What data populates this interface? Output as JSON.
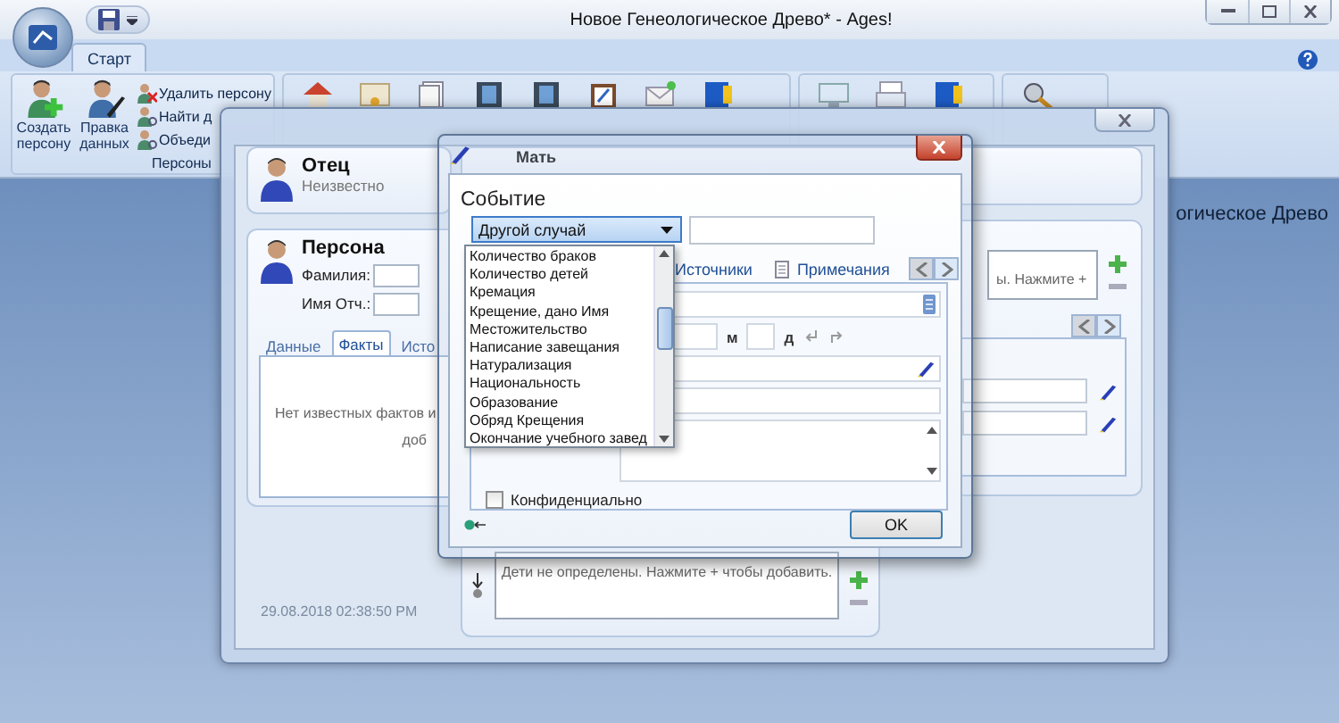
{
  "window": {
    "title": "Новое Генеологическое Древо* - Ages!"
  },
  "ribbon": {
    "tabs": [
      {
        "label": "Старт",
        "selected": true
      }
    ],
    "group": {
      "label": "Персоны",
      "large_buttons": [
        "Создать персону",
        "Правка данных"
      ],
      "small_buttons": [
        "Удалить персону",
        "Найти д",
        "Объеди"
      ]
    }
  },
  "workspace": {
    "heading": "огическое Древо"
  },
  "person_window": {
    "father": {
      "title": "Отец",
      "subtitle": "Неизвестно"
    },
    "mother": {
      "title": "Мать"
    },
    "person": {
      "title": "Персона",
      "fields": [
        {
          "label": "Фамилия:"
        },
        {
          "label": "Имя Отч.:"
        }
      ],
      "tabs": [
        {
          "label": "Данные",
          "selected": false
        },
        {
          "label": "Факты",
          "selected": true
        },
        {
          "label": "Исто",
          "selected": false
        }
      ],
      "empty_text": [
        "Нет известных фактов и",
        "доб"
      ]
    },
    "spouse_hint": "ы. Нажмите +",
    "children_hint": "Дети не определены. Нажмите + чтобы добавить.",
    "timestamp": "29.08.2018 02:38:50 PM"
  },
  "event_dialog": {
    "label": "Событие",
    "event_type": "Другой случай",
    "tabs": [
      {
        "label": "Источники",
        "selected": false
      },
      {
        "label": "Примечания",
        "selected": false
      }
    ],
    "date_labels": [
      "м",
      "д"
    ],
    "confidential": {
      "label": "Конфиденциально",
      "checked": false
    },
    "ok": "OK",
    "dropdown": {
      "items": [
        "Количество браков",
        "Количество детей",
        "Кремация",
        "Крещение, дано Имя",
        "Местожительство",
        "Написание завещания",
        "Натурализация",
        "Национальность",
        "Образование",
        "Обряд Крещения",
        "Окончание учебного завед"
      ]
    }
  }
}
